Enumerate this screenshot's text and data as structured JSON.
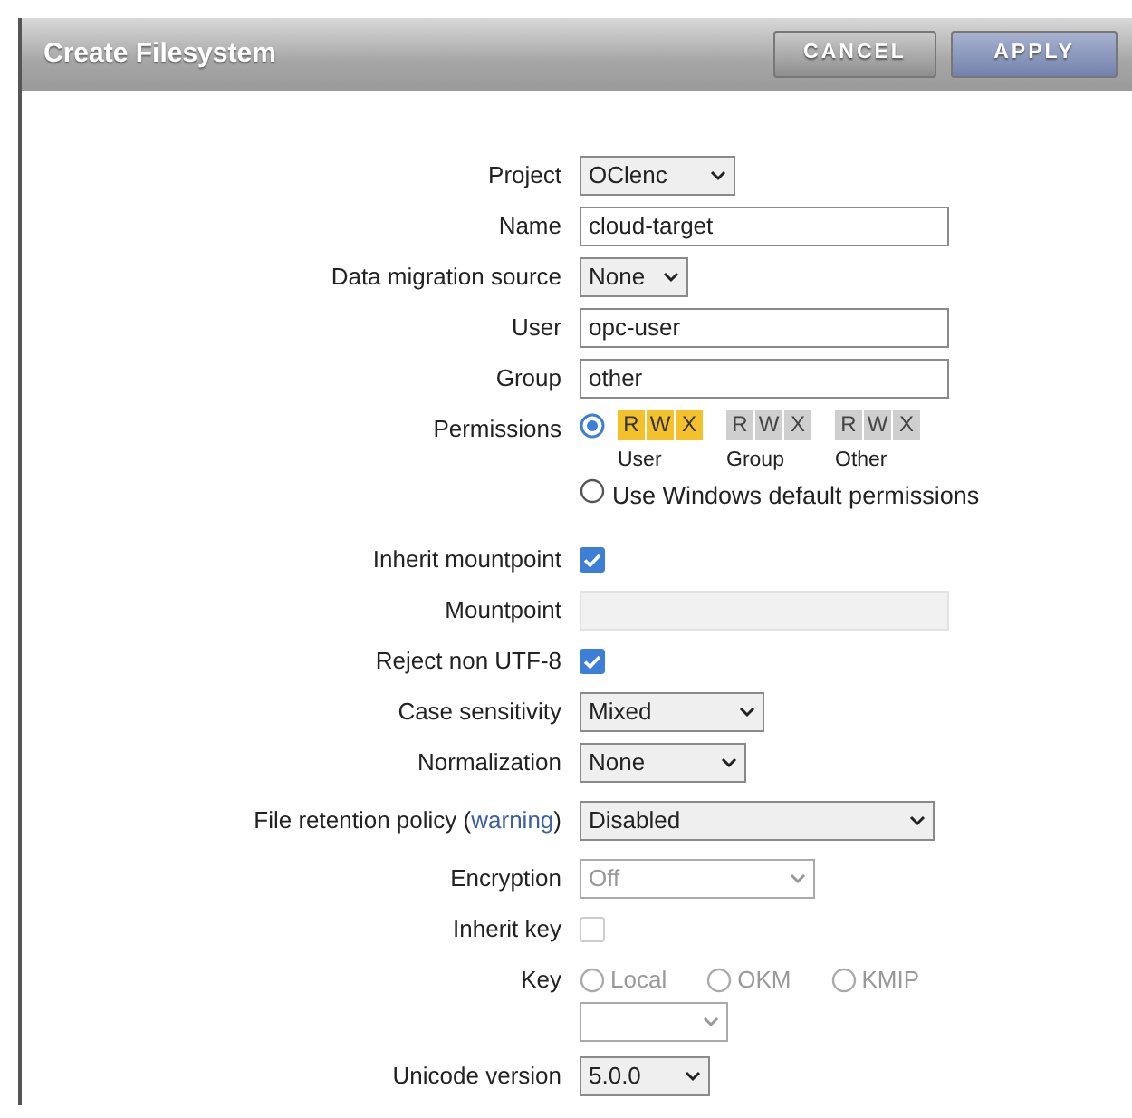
{
  "dialog": {
    "title": "Create Filesystem",
    "buttons": [
      {
        "label": "CANCEL",
        "kind": "secondary"
      },
      {
        "label": "APPLY",
        "kind": "primary"
      }
    ]
  },
  "fields": [
    {
      "kind": "select",
      "label": "Project",
      "value": "OClenc",
      "disabled": false
    },
    {
      "kind": "text",
      "label": "Name",
      "value": "cloud-target",
      "disabled": false
    },
    {
      "kind": "select",
      "label": "Data migration source",
      "value": "None",
      "disabled": false
    },
    {
      "kind": "text",
      "label": "User",
      "value": "opc-user",
      "disabled": false
    },
    {
      "kind": "text",
      "label": "Group",
      "value": "other",
      "disabled": false
    },
    {
      "kind": "permissions",
      "label": "Permissions",
      "options": [
        {
          "kind": "modes",
          "selected": true,
          "groups": [
            {
              "label": "User",
              "bits": [
                {
                  "letter": "R",
                  "on": true
                },
                {
                  "letter": "W",
                  "on": true
                },
                {
                  "letter": "X",
                  "on": true
                }
              ]
            },
            {
              "label": "Group",
              "bits": [
                {
                  "letter": "R",
                  "on": false
                },
                {
                  "letter": "W",
                  "on": false
                },
                {
                  "letter": "X",
                  "on": false
                }
              ]
            },
            {
              "label": "Other",
              "bits": [
                {
                  "letter": "R",
                  "on": false
                },
                {
                  "letter": "W",
                  "on": false
                },
                {
                  "letter": "X",
                  "on": false
                }
              ]
            }
          ]
        },
        {
          "kind": "text",
          "label": "Use Windows default permissions",
          "selected": false
        }
      ]
    },
    {
      "kind": "checkbox",
      "label": "Inherit mountpoint",
      "checked": true,
      "disabled": false
    },
    {
      "kind": "text",
      "label": "Mountpoint",
      "disabled": true
    },
    {
      "kind": "checkbox",
      "label": "Reject non UTF-8",
      "checked": true,
      "disabled": false
    },
    {
      "kind": "select",
      "label": "Case sensitivity",
      "value": "Mixed",
      "disabled": false
    },
    {
      "kind": "select",
      "label": "Normalization",
      "value": "None",
      "disabled": false
    },
    {
      "kind": "select",
      "label": "File retention policy (",
      "link": "warning",
      "label_after": ")",
      "value": "Disabled",
      "disabled": false
    },
    {
      "kind": "select",
      "label": "Encryption",
      "value": "Off",
      "disabled": true
    },
    {
      "kind": "checkbox",
      "label": "Inherit key",
      "checked": false,
      "disabled": true
    },
    {
      "kind": "key",
      "label": "Key",
      "disabled": true,
      "options": [
        {
          "label": "Local",
          "selected": false
        },
        {
          "label": "OKM",
          "selected": false
        },
        {
          "label": "KMIP",
          "selected": false
        }
      ]
    },
    {
      "kind": "select",
      "label": "Unicode version",
      "value": "5.0.0",
      "disabled": false
    }
  ]
}
